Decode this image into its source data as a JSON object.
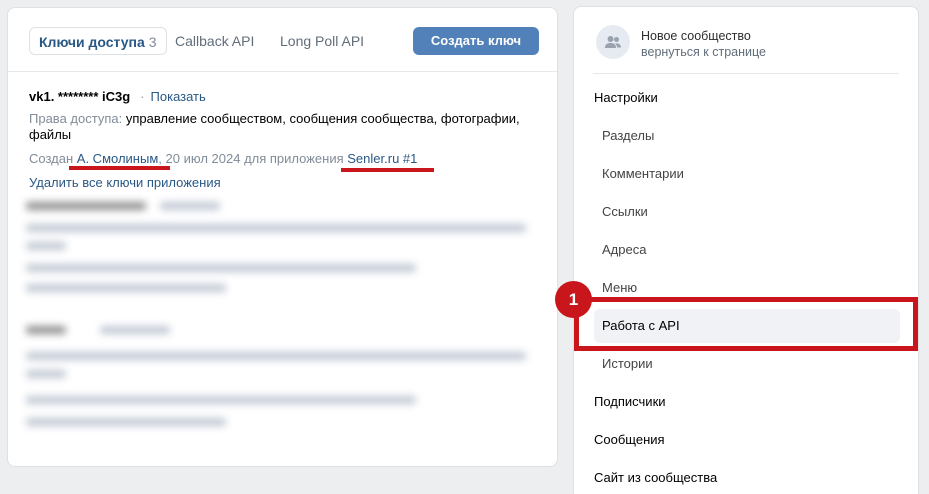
{
  "tabs": {
    "keys_label": "Ключи доступа",
    "keys_count": "3",
    "callback_label": "Callback API",
    "longpoll_label": "Long Poll API",
    "create_button": "Создать ключ"
  },
  "key": {
    "name": "vk1. ******** iC3g",
    "show_link": "Показать",
    "rights_label": "Права доступа:",
    "rights_value": "управление сообществом, сообщения сообщества, фотографии, файлы",
    "created_label": "Создан",
    "created_by": "А. Смолиным",
    "created_sep": ",",
    "created_date": "20 июл 2024",
    "created_app_label": "для приложения",
    "created_app": "Senler.ru #1",
    "delete_link": "Удалить все ключи приложения"
  },
  "community": {
    "name": "Новое сообщество",
    "back": "вернуться к странице"
  },
  "menu": {
    "settings": "Настройки",
    "sections": "Разделы",
    "comments": "Комментарии",
    "links": "Ссылки",
    "addresses": "Адреса",
    "menu": "Меню",
    "api": "Работа с API",
    "stories": "Истории",
    "subscribers": "Подписчики",
    "messages": "Сообщения",
    "site": "Сайт из сообщества"
  },
  "annotation": {
    "badge": "1",
    "color": "#c8161c"
  },
  "colors": {
    "accent": "#5181b8",
    "link": "#2a5885",
    "background": "#edeef0"
  }
}
